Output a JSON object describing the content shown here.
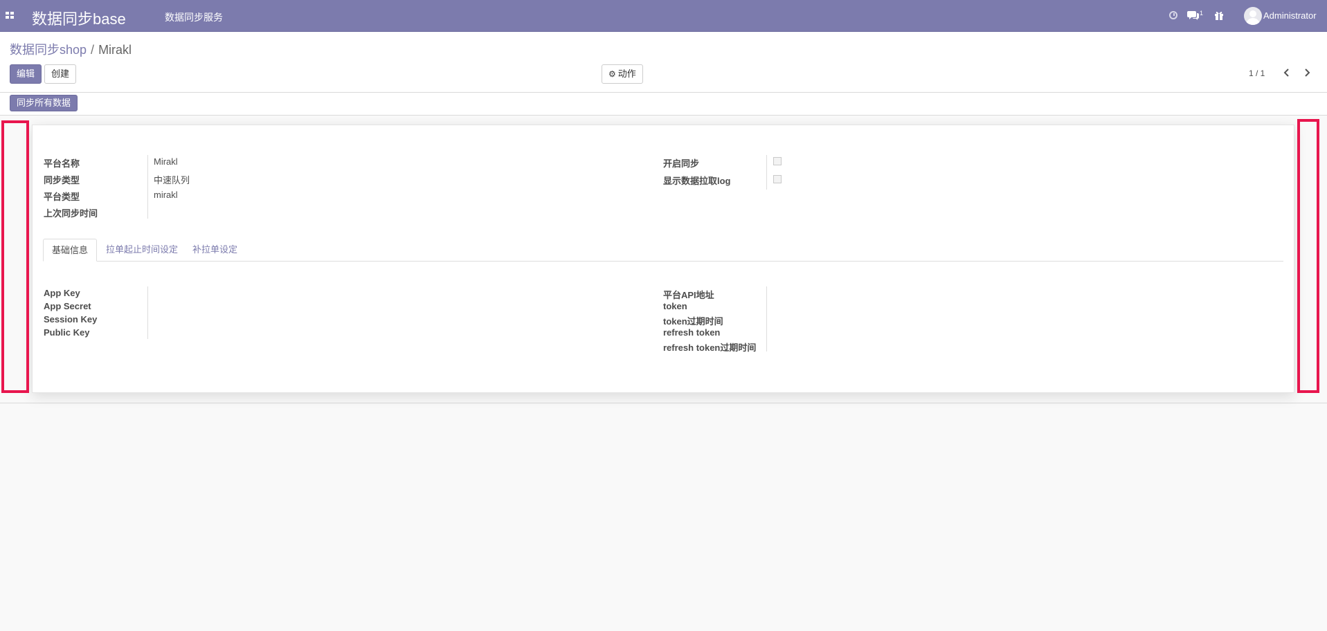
{
  "navbar": {
    "apps_icon": "grid-icon",
    "brand": "数据同步base",
    "menu_item": "数据同步服务",
    "chat_badge": "1",
    "user_name": "Administrator",
    "color": "#7c7bad"
  },
  "breadcrumb": {
    "parent": "数据同步shop",
    "separator": "/",
    "current": "Mirakl"
  },
  "buttons": {
    "edit": "编辑",
    "create": "创建",
    "action": "动作",
    "sync_all": "同步所有数据"
  },
  "pager": {
    "value": "1 / 1"
  },
  "form": {
    "left_fields": [
      {
        "label": "平台名称",
        "value": "Mirakl"
      },
      {
        "label": "同步类型",
        "value": "中速队列"
      },
      {
        "label": "平台类型",
        "value": "mirakl"
      },
      {
        "label": "上次同步时间",
        "value": ""
      }
    ],
    "right_fields": [
      {
        "label": "开启同步",
        "checked": false
      },
      {
        "label": "显示数据拉取log",
        "checked": false
      }
    ]
  },
  "tabs": [
    {
      "label": "基础信息",
      "active": true
    },
    {
      "label": "拉单起止时间设定",
      "active": false
    },
    {
      "label": "补拉单设定",
      "active": false
    }
  ],
  "tab_content": {
    "left_fields": [
      "App Key",
      "App Secret",
      "Session Key",
      "Public Key"
    ],
    "right_fields": [
      "平台API地址",
      "token",
      "token过期时间",
      "refresh token",
      "refresh token过期时间"
    ]
  }
}
